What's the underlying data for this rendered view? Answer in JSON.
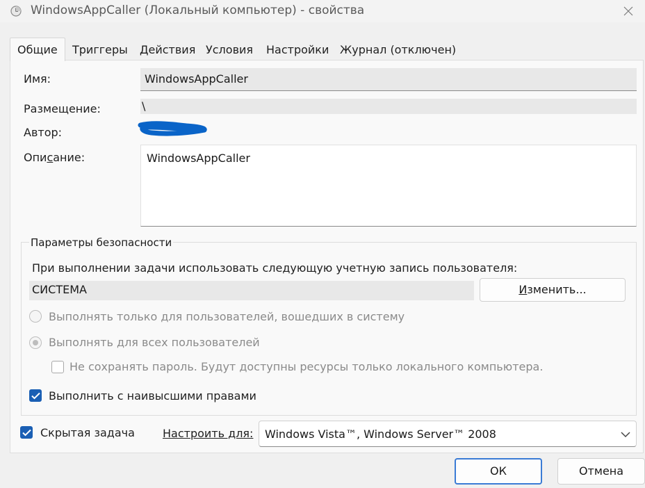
{
  "window": {
    "title": "WindowsAppCaller (Локальный компьютер) - свойства",
    "app_icon": "task-scheduler-clock-icon",
    "close_icon": "close-icon"
  },
  "tabs": [
    {
      "label": "Общие",
      "active": true
    },
    {
      "label": "Триггеры"
    },
    {
      "label": "Действия"
    },
    {
      "label": "Условия"
    },
    {
      "label": "Настройки"
    },
    {
      "label": "Журнал (отключен)"
    }
  ],
  "general": {
    "name_label": "Имя:",
    "name_value": "WindowsAppCaller",
    "location_label": "Размещение:",
    "location_value": "\\",
    "author_label": "Автор:",
    "description_label": "Описание:",
    "description_value": "WindowsAppCaller"
  },
  "security": {
    "group_title": "Параметры безопасности",
    "account_prompt": "При выполнении задачи использовать следующую учетную запись пользователя:",
    "account_value": "СИСТЕМА",
    "change_button": "Изменить...",
    "radio_logged_on": "Выполнять только для пользователей, вошедших в систему",
    "radio_all_users": "Выполнять для всех пользователей",
    "dont_store_password": "Не сохранять пароль. Будут доступны ресурсы только локального компьютера.",
    "highest_privileges": "Выполнить с наивысшими правами"
  },
  "bottom": {
    "hidden_task": "Скрытая задача",
    "configure_for_label": "Настроить для:",
    "configure_for_value": "Windows Vista™, Windows Server™ 2008"
  },
  "buttons": {
    "ok": "ОК",
    "cancel": "Отмена"
  },
  "colors": {
    "accent": "#1a5fb4",
    "default_button_border": "#3a7bd5",
    "window_bg": "#f0f0f0",
    "redaction_scribble": "#0a64c8"
  }
}
